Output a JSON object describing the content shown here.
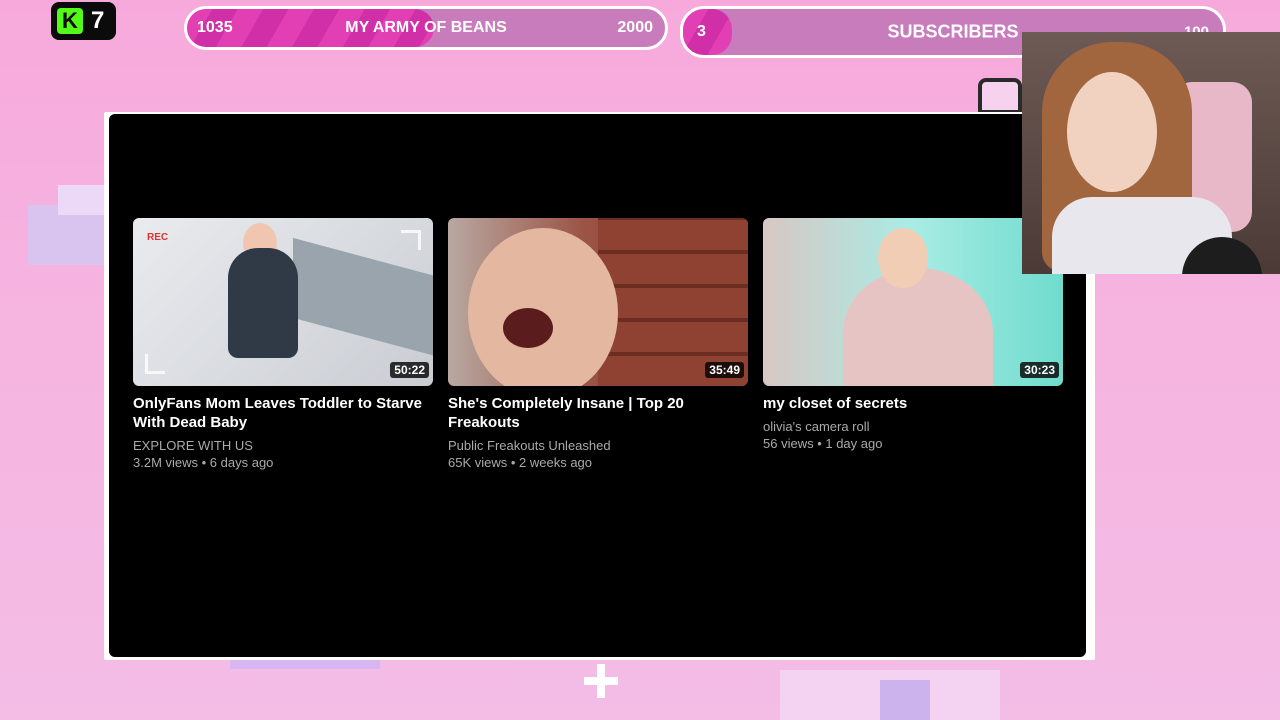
{
  "overlay": {
    "logo_count": "7",
    "logo_letter": "K",
    "goal1": {
      "current": "1035",
      "label": "MY ARMY OF BEANS",
      "target": "2000",
      "progress": 0.5175
    },
    "goal2": {
      "current": "3",
      "label": "SUBSCRIBERS",
      "target": "100",
      "progress": 0.03
    }
  },
  "videos": [
    {
      "title": "OnlyFans Mom Leaves Toddler to Starve With Dead Baby",
      "channel": "EXPLORE WITH US",
      "meta": "3.2M views • 6 days ago",
      "duration": "50:22",
      "badge": "REC"
    },
    {
      "title": "She's Completely Insane | Top 20 Freakouts",
      "channel": "Public Freakouts Unleashed",
      "meta": "65K views • 2 weeks ago",
      "duration": "35:49"
    },
    {
      "title": "my closet of secrets",
      "channel": "olivia's camera roll",
      "meta": "56 views • 1 day ago",
      "duration": "30:23"
    }
  ],
  "colors": {
    "background": "#f7a9dc",
    "goal_fill": "#e23fb5",
    "panel": "#000000",
    "kick_green": "#53fc18"
  }
}
